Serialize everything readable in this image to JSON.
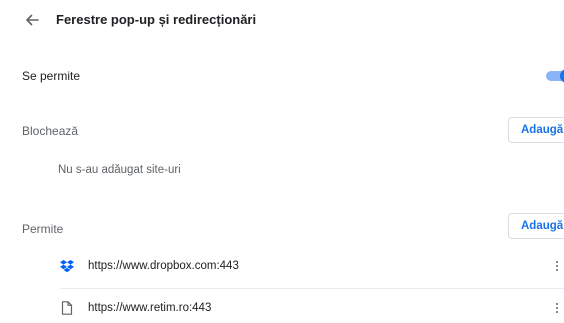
{
  "header": {
    "title": "Ferestre pop-up și redirecționări",
    "back_icon": "arrow-back-icon"
  },
  "allowed_toggle": {
    "label": "Se permite",
    "checked": true,
    "accent": "#1a73e8"
  },
  "block_section": {
    "label": "Blochează",
    "add_label": "Adaugă",
    "empty_text": "Nu s-au adăugat site-uri"
  },
  "allow_section": {
    "label": "Permite",
    "add_label": "Adaugă",
    "sites": [
      {
        "url": "https://www.dropbox.com:443",
        "icon": "dropbox-icon"
      },
      {
        "url": "https://www.retim.ro:443",
        "icon": "document-icon"
      }
    ]
  }
}
